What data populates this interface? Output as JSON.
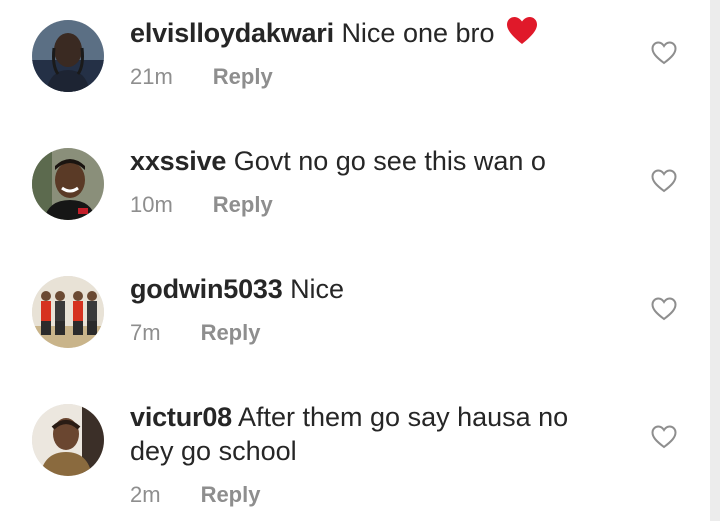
{
  "comments": [
    {
      "username": "elvislloydakwari",
      "text": "Nice one bro",
      "emoji": "red-heart-emoji",
      "time": "21m",
      "reply_label": "Reply",
      "like_icon": "heart-outline-icon"
    },
    {
      "username": "xxssive",
      "text": "Govt no go see this wan o",
      "time": "10m",
      "reply_label": "Reply",
      "like_icon": "heart-outline-icon"
    },
    {
      "username": "godwin5033",
      "text": "Nice",
      "time": "7m",
      "reply_label": "Reply",
      "like_icon": "heart-outline-icon"
    },
    {
      "username": "victur08",
      "text": "After them go say hausa no",
      "text_line2": "dey go school",
      "time": "2m",
      "reply_label": "Reply",
      "like_icon": "heart-outline-icon"
    }
  ],
  "colors": {
    "text": "#262626",
    "muted": "#8e8e8e",
    "heart_emoji": "#e0192a"
  }
}
